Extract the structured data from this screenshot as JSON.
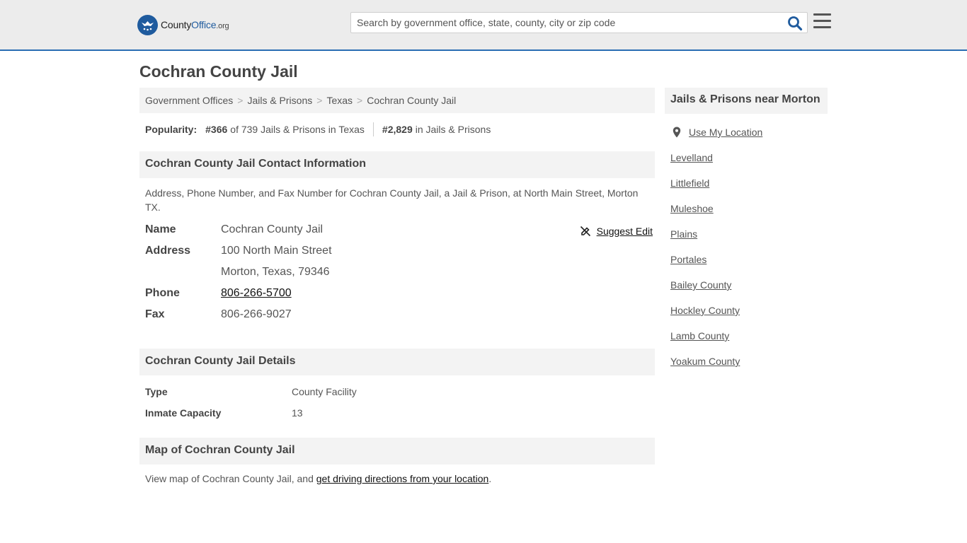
{
  "header": {
    "logo": {
      "part1": "County",
      "part2": "Office",
      "part3": ".org"
    },
    "search_placeholder": "Search by government office, state, county, city or zip code"
  },
  "page_title": "Cochran County Jail",
  "breadcrumb": [
    "Government Offices",
    "Jails & Prisons",
    "Texas",
    "Cochran County Jail"
  ],
  "popularity": {
    "label": "Popularity:",
    "state_rank": "#366",
    "state_rank_text": "of 739 Jails & Prisons in Texas",
    "national_rank": "#2,829",
    "national_rank_text": "in Jails & Prisons"
  },
  "contact": {
    "heading": "Cochran County Jail Contact Information",
    "description": "Address, Phone Number, and Fax Number for Cochran County Jail, a Jail & Prison, at North Main Street, Morton TX.",
    "suggest_edit": "Suggest Edit",
    "rows": {
      "name_label": "Name",
      "name_value": "Cochran County Jail",
      "address_label": "Address",
      "address_line1": "100 North Main Street",
      "address_line2": "Morton, Texas, 79346",
      "phone_label": "Phone",
      "phone_value": "806-266-5700",
      "fax_label": "Fax",
      "fax_value": "806-266-9027"
    }
  },
  "details": {
    "heading": "Cochran County Jail Details",
    "type_label": "Type",
    "type_value": "County Facility",
    "capacity_label": "Inmate Capacity",
    "capacity_value": "13"
  },
  "map": {
    "heading": "Map of Cochran County Jail",
    "text_before": "View map of Cochran County Jail, and",
    "link": "get driving directions from your location",
    "text_after": "."
  },
  "sidebar": {
    "heading": "Jails & Prisons near Morton",
    "use_location": "Use My Location",
    "items": [
      "Levelland",
      "Littlefield",
      "Muleshoe",
      "Plains",
      "Portales",
      "Bailey County",
      "Hockley County",
      "Lamb County",
      "Yoakum County"
    ]
  },
  "colors": {
    "accent": "#2a6db3",
    "logo_blue": "#1f5b9e",
    "panel": "#f3f3f3"
  }
}
